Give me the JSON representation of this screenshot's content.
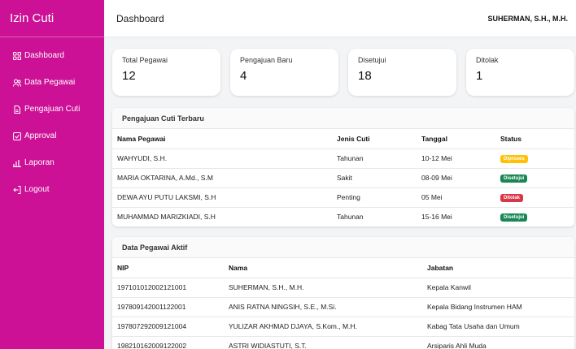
{
  "app_title": "Izin Cuti",
  "sidebar": {
    "items": [
      {
        "label": "Dashboard",
        "icon": "grid-icon"
      },
      {
        "label": "Data Pegawai",
        "icon": "users-icon"
      },
      {
        "label": "Pengajuan Cuti",
        "icon": "document-icon"
      },
      {
        "label": "Approval",
        "icon": "check-square-icon"
      },
      {
        "label": "Laporan",
        "icon": "bar-chart-icon"
      },
      {
        "label": "Logout",
        "icon": "logout-icon"
      }
    ]
  },
  "header": {
    "title": "Dashboard",
    "user": "SUHERMAN, S.H., M.H."
  },
  "stats": [
    {
      "label": "Total Pegawai",
      "value": "12"
    },
    {
      "label": "Pengajuan Baru",
      "value": "4"
    },
    {
      "label": "Disetujui",
      "value": "18"
    },
    {
      "label": "Ditolak",
      "value": "1"
    }
  ],
  "leave_table": {
    "title": "Pengajuan Cuti Terbaru",
    "headers": [
      "Nama Pegawai",
      "Jenis Cuti",
      "Tanggal",
      "Status"
    ],
    "rows": [
      {
        "nama": "WAHYUDI, S.H.",
        "jenis": "Tahunan",
        "tanggal": "10-12 Mei",
        "status": "Diproses",
        "status_type": "warn"
      },
      {
        "nama": "MARIA OKTARINA, A.Md., S.M",
        "jenis": "Sakit",
        "tanggal": "08-09 Mei",
        "status": "Disetujui",
        "status_type": "ok"
      },
      {
        "nama": "DEWA AYU PUTU LAKSMI, S.H",
        "jenis": "Penting",
        "tanggal": "05 Mei",
        "status": "Ditolak",
        "status_type": "danger"
      },
      {
        "nama": "MUHAMMAD MARIZKIADI, S.H",
        "jenis": "Tahunan",
        "tanggal": "15-16 Mei",
        "status": "Disetujui",
        "status_type": "ok"
      }
    ]
  },
  "employee_table": {
    "title": "Data Pegawai Aktif",
    "headers": [
      "NIP",
      "Nama",
      "Jabatan"
    ],
    "rows": [
      {
        "nip": "197101012002121001",
        "nama": "SUHERMAN, S.H., M.H.",
        "jabatan": "Kepala Kanwil"
      },
      {
        "nip": "197809142001122001",
        "nama": "ANIS RATNA NINGSIH, S.E., M.Si.",
        "jabatan": "Kepala Bidang Instrumen HAM"
      },
      {
        "nip": "197807292009121004",
        "nama": "YULIZAR AKHMAD DJAYA, S.Kom., M.H.",
        "jabatan": "Kabag Tata Usaha dan Umum"
      },
      {
        "nip": "198210162009122002",
        "nama": "ASTRI WIDIASTUTI, S.T.",
        "jabatan": "Arsiparis Ahli Muda"
      }
    ]
  },
  "colors": {
    "sidebar": "#cc1196",
    "warn": "#ffc107",
    "ok": "#198754",
    "danger": "#dc3545"
  }
}
